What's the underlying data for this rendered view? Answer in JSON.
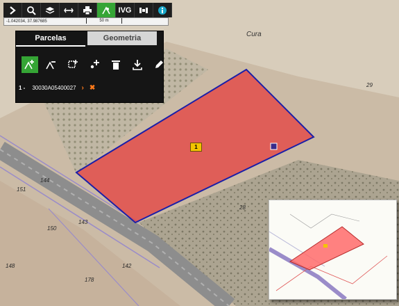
{
  "toolbar": {
    "buttons": [
      {
        "name": "expand-button",
        "icon": "chevron-right-icon",
        "label": ""
      },
      {
        "name": "search-button",
        "icon": "search-icon",
        "label": ""
      },
      {
        "name": "layers-button",
        "icon": "layers-icon",
        "label": ""
      },
      {
        "name": "measure-button",
        "icon": "measure-icon",
        "label": ""
      },
      {
        "name": "print-button",
        "icon": "printer-icon",
        "label": ""
      },
      {
        "name": "parcel-tool-button",
        "icon": "parcel-icon",
        "label": ""
      },
      {
        "name": "ivg-button",
        "icon": "",
        "label": "IVG"
      },
      {
        "name": "satellite-button",
        "icon": "satellite-icon",
        "label": ""
      },
      {
        "name": "info-button",
        "icon": "info-icon",
        "label": ""
      }
    ]
  },
  "status": {
    "coordinates": "-1.042034, 37.987685",
    "scale": "50 m"
  },
  "panel": {
    "tabs": [
      {
        "label": "Parcelas"
      },
      {
        "label": "Geometria"
      }
    ],
    "tools": [
      {
        "name": "add-parcel-icon"
      },
      {
        "name": "remove-parcel-icon"
      },
      {
        "name": "select-area-icon"
      },
      {
        "name": "add-point-icon"
      },
      {
        "name": "delete-icon"
      },
      {
        "name": "download-icon"
      },
      {
        "name": "edit-icon"
      }
    ],
    "parcels": [
      {
        "index": "1 -",
        "ref": "30030A05400027"
      }
    ]
  },
  "map": {
    "place_name": "Cura",
    "parcel_marker": "1",
    "parcel_numbers": [
      "151",
      "150",
      "143",
      "142",
      "148",
      "178",
      "144",
      "28",
      "29",
      "152"
    ],
    "parcel_color": "#e63a3a",
    "boundary_color": "#1b1fa8"
  }
}
